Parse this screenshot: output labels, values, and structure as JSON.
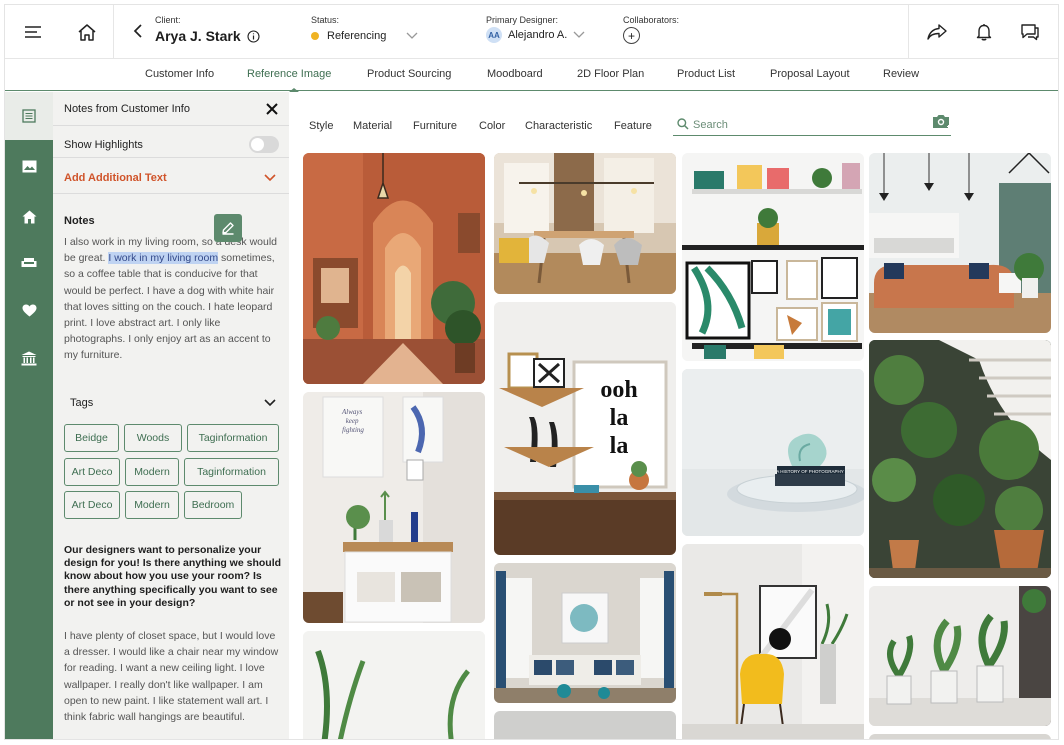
{
  "header": {
    "client_label": "Client:",
    "client_name": "Arya J. Stark",
    "status_label": "Status:",
    "status_value": "Referencing",
    "designer_label": "Primary Designer:",
    "designer_initials": "AA",
    "designer_name": "Alejandro A.",
    "collaborators_label": "Collaborators:",
    "add_collaborator": "+"
  },
  "tabs": [
    {
      "label": "Customer Info"
    },
    {
      "label": "Reference Image",
      "active": true
    },
    {
      "label": "Product Sourcing"
    },
    {
      "label": "Moodboard"
    },
    {
      "label": "2D Floor Plan"
    },
    {
      "label": "Product List"
    },
    {
      "label": "Proposal Layout"
    },
    {
      "label": "Review"
    }
  ],
  "panel": {
    "title": "Notes from Customer Info",
    "show_highlights_label": "Show Highlights",
    "show_highlights_on": false,
    "add_text_label": "Add Additional Text",
    "notes_heading": "Notes",
    "notes_before": "I also work in my living room, so a desk would be great. ",
    "notes_highlight": "I work in my living room",
    "notes_after": " sometimes, so a coffee table that is conducive for that would be perfect. I have a dog with white hair that loves sitting on the couch. I hate leopard print. I love abstract art. I only like photographs. I only enjoy art as an accent to my furniture.",
    "tags_label": "Tags",
    "tags": [
      "Beidge",
      "Woods",
      "Taginformation",
      "Art Deco",
      "Modern",
      "Taginformation",
      "Art Deco",
      "Modern",
      "Bedroom"
    ],
    "question": "Our designers want to personalize your design for you! Is there anything we should know about how you use your room? Is there anything specifically you want to see or not see in your design?",
    "answer": "I have plenty of closet space, but I would love a dresser. I would like a chair near my window for reading. I want a new ceiling light. I love wallpaper. I really don't like wallpaper. I am open to new paint. I like statement wall art. I think fabric wall hangings are beautiful."
  },
  "filters": [
    "Style",
    "Material",
    "Furniture",
    "Color",
    "Characteristic",
    "Feature"
  ],
  "search": {
    "placeholder": "Search"
  },
  "images": {
    "ooh_la_la": "ooh la la",
    "book_title": "A HISTORY OF PHOTOGRAPHY",
    "poster_text": "Always keep fighting"
  },
  "colors": {
    "accent": "#5d8a6d",
    "rail": "#4e7a5d",
    "warning": "#d0542a",
    "status": "#f0b323"
  }
}
